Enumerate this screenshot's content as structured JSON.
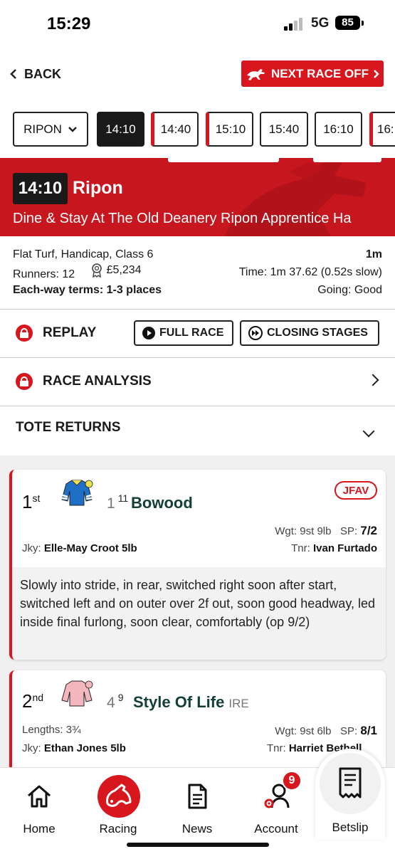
{
  "status": {
    "time": "15:29",
    "network": "5G",
    "battery": "85"
  },
  "nav": {
    "back_label": "BACK",
    "next_race_label": "NEXT RACE OFF"
  },
  "tabs": {
    "course": "RIPON",
    "times": [
      "14:10",
      "14:40",
      "15:10",
      "15:40",
      "16:10",
      "16:"
    ],
    "active_index": 0
  },
  "race": {
    "time": "14:10",
    "course": "Ripon",
    "name": "Dine & Stay At The Old Deanery Ripon Apprentice Ha",
    "type": "Flat Turf, Handicap, Class 6",
    "distance": "1m",
    "runners": "Runners: 12",
    "prize": "£5,234",
    "time_result": "Time: 1m 37.62 (0.52s slow)",
    "each_way": "Each-way terms: 1-3 places",
    "going": "Going: Good"
  },
  "sections": {
    "replay_label": "REPLAY",
    "full_race_label": "FULL RACE",
    "closing_stages_label": "CLOSING STAGES",
    "analysis_label": "RACE ANALYSIS",
    "tote_label": "TOTE RETURNS"
  },
  "runners": [
    {
      "position": "1",
      "position_suffix": "st",
      "number": "1",
      "draw": "11",
      "horse": "Bowood",
      "country": "",
      "badge": "JFAV",
      "lengths": "",
      "weight_label": "Wgt:",
      "weight": "9st 9lb",
      "sp_label": "SP:",
      "sp": "7/2",
      "jockey_label": "Jky:",
      "jockey": "Elle-May Croot 5lb",
      "trainer_label": "Tnr:",
      "trainer": "Ivan Furtado",
      "comment": "Slowly into stride, in rear, switched right soon after start, switched left and on outer over 2f out, soon good headway, led inside final furlong, soon clear, comfortably (op 9/2)"
    },
    {
      "position": "2",
      "position_suffix": "nd",
      "number": "4",
      "draw": "9",
      "horse": "Style Of Life",
      "country": "IRE",
      "badge": "",
      "lengths": "Lengths: 3¾",
      "weight_label": "Wgt:",
      "weight": "9st 6lb",
      "sp_label": "SP:",
      "sp": "8/1",
      "jockey_label": "Jky:",
      "jockey": "Ethan Jones 5lb",
      "trainer_label": "Tnr:",
      "trainer": "Harriet Bethell",
      "comment": ""
    }
  ],
  "bottom_nav": {
    "home": "Home",
    "racing": "Racing",
    "news": "News",
    "account": "Account",
    "account_badge": "9",
    "betslip": "Betslip"
  },
  "colors": {
    "brand_red": "#d7161e",
    "dark": "#1a1a1a",
    "horse_name": "#123f36"
  }
}
